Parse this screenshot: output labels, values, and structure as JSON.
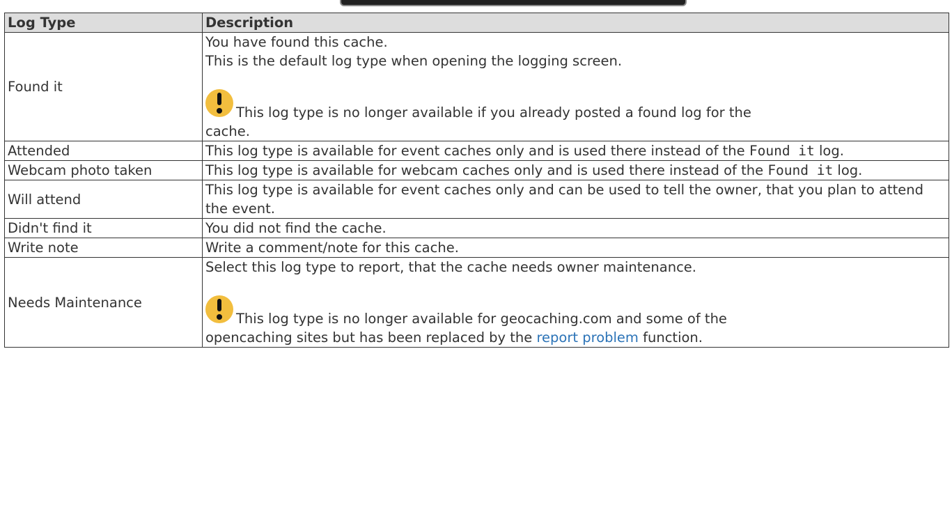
{
  "table": {
    "headers": {
      "log_type": "Log Type",
      "description": "Description"
    },
    "rows": [
      {
        "type": "Found it",
        "lines": [
          "You have found this cache.",
          "This is the default log type when opening the logging screen."
        ],
        "note": {
          "icon": "exclamation-icon",
          "text1": "This log type is no longer available if you already posted a found log for the",
          "text2": "cache."
        }
      },
      {
        "type": "Attended",
        "text_before": "This log type is available for event caches only and is used there instead of the ",
        "code": "Found it",
        "text_after": " log."
      },
      {
        "type": "Webcam photo taken",
        "text_before": "This log type is available for webcam caches only and is used there instead of the ",
        "code": "Found it",
        "text_after": " log."
      },
      {
        "type": "Will attend",
        "text": "This log type is available for event caches only and can be used to tell the owner, that you plan to attend the event."
      },
      {
        "type": "Didn't find it",
        "text": "You did not find the cache."
      },
      {
        "type": "Write note",
        "text": "Write a comment/note for this cache."
      },
      {
        "type": "Needs Maintenance",
        "text": "Select this log type to report, that the cache needs owner maintenance.",
        "note": {
          "icon": "exclamation-icon",
          "text1": "This log type is no longer available for geocaching.com and some of the",
          "text2_before": "opencaching sites but has been replaced by the ",
          "link": "report problem",
          "text2_after": " function."
        }
      }
    ]
  },
  "colors": {
    "note_icon": "#f2be3e",
    "link": "#2b73b7",
    "header_bg": "#dddddd"
  }
}
